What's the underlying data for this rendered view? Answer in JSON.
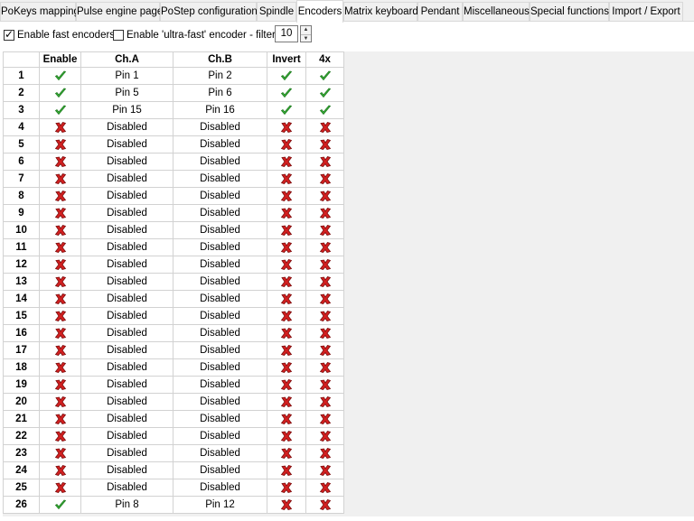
{
  "tabs": [
    {
      "label": "PoKeys mapping",
      "active": false
    },
    {
      "label": "Pulse engine page",
      "active": false
    },
    {
      "label": "PoStep configuration",
      "active": false
    },
    {
      "label": "Spindle",
      "active": false
    },
    {
      "label": "Encoders",
      "active": true
    },
    {
      "label": "Matrix keyboard",
      "active": false
    },
    {
      "label": "Pendant",
      "active": false
    },
    {
      "label": "Miscellaneous",
      "active": false
    },
    {
      "label": "Special functions",
      "active": false
    },
    {
      "label": "Import / Export",
      "active": false
    }
  ],
  "options": {
    "fast_encoders": {
      "label": "Enable fast encoders",
      "checked": true
    },
    "ultra_fast": {
      "label": "Enable 'ultra-fast' encoder - filter:",
      "checked": false
    },
    "filter_value": "10"
  },
  "table": {
    "headers": [
      "",
      "Enable",
      "Ch.A",
      "Ch.B",
      "Invert",
      "4x"
    ],
    "rows": [
      {
        "num": "1",
        "enable": true,
        "cha": "Pin 1",
        "chb": "Pin 2",
        "invert": true,
        "x4": true
      },
      {
        "num": "2",
        "enable": true,
        "cha": "Pin 5",
        "chb": "Pin 6",
        "invert": true,
        "x4": true
      },
      {
        "num": "3",
        "enable": true,
        "cha": "Pin 15",
        "chb": "Pin 16",
        "invert": true,
        "x4": true
      },
      {
        "num": "4",
        "enable": false,
        "cha": "Disabled",
        "chb": "Disabled",
        "invert": false,
        "x4": false
      },
      {
        "num": "5",
        "enable": false,
        "cha": "Disabled",
        "chb": "Disabled",
        "invert": false,
        "x4": false
      },
      {
        "num": "6",
        "enable": false,
        "cha": "Disabled",
        "chb": "Disabled",
        "invert": false,
        "x4": false
      },
      {
        "num": "7",
        "enable": false,
        "cha": "Disabled",
        "chb": "Disabled",
        "invert": false,
        "x4": false
      },
      {
        "num": "8",
        "enable": false,
        "cha": "Disabled",
        "chb": "Disabled",
        "invert": false,
        "x4": false
      },
      {
        "num": "9",
        "enable": false,
        "cha": "Disabled",
        "chb": "Disabled",
        "invert": false,
        "x4": false
      },
      {
        "num": "10",
        "enable": false,
        "cha": "Disabled",
        "chb": "Disabled",
        "invert": false,
        "x4": false
      },
      {
        "num": "11",
        "enable": false,
        "cha": "Disabled",
        "chb": "Disabled",
        "invert": false,
        "x4": false
      },
      {
        "num": "12",
        "enable": false,
        "cha": "Disabled",
        "chb": "Disabled",
        "invert": false,
        "x4": false
      },
      {
        "num": "13",
        "enable": false,
        "cha": "Disabled",
        "chb": "Disabled",
        "invert": false,
        "x4": false
      },
      {
        "num": "14",
        "enable": false,
        "cha": "Disabled",
        "chb": "Disabled",
        "invert": false,
        "x4": false
      },
      {
        "num": "15",
        "enable": false,
        "cha": "Disabled",
        "chb": "Disabled",
        "invert": false,
        "x4": false
      },
      {
        "num": "16",
        "enable": false,
        "cha": "Disabled",
        "chb": "Disabled",
        "invert": false,
        "x4": false
      },
      {
        "num": "17",
        "enable": false,
        "cha": "Disabled",
        "chb": "Disabled",
        "invert": false,
        "x4": false
      },
      {
        "num": "18",
        "enable": false,
        "cha": "Disabled",
        "chb": "Disabled",
        "invert": false,
        "x4": false
      },
      {
        "num": "19",
        "enable": false,
        "cha": "Disabled",
        "chb": "Disabled",
        "invert": false,
        "x4": false
      },
      {
        "num": "20",
        "enable": false,
        "cha": "Disabled",
        "chb": "Disabled",
        "invert": false,
        "x4": false
      },
      {
        "num": "21",
        "enable": false,
        "cha": "Disabled",
        "chb": "Disabled",
        "invert": false,
        "x4": false
      },
      {
        "num": "22",
        "enable": false,
        "cha": "Disabled",
        "chb": "Disabled",
        "invert": false,
        "x4": false
      },
      {
        "num": "23",
        "enable": false,
        "cha": "Disabled",
        "chb": "Disabled",
        "invert": false,
        "x4": false
      },
      {
        "num": "24",
        "enable": false,
        "cha": "Disabled",
        "chb": "Disabled",
        "invert": false,
        "x4": false
      },
      {
        "num": "25",
        "enable": false,
        "cha": "Disabled",
        "chb": "Disabled",
        "invert": false,
        "x4": false
      },
      {
        "num": "26",
        "enable": true,
        "cha": "Pin 8",
        "chb": "Pin 12",
        "invert": false,
        "x4": false
      }
    ]
  },
  "colors": {
    "check_green": "#3bb53b",
    "cross_red": "#d42020",
    "grid_line": "#d2d2d2",
    "tab_bg": "#f0f0f0"
  },
  "icons": {
    "enabled": "green-check-icon",
    "disabled": "red-cross-icon",
    "spin_up": "arrow-up-icon",
    "spin_down": "arrow-down-icon"
  }
}
